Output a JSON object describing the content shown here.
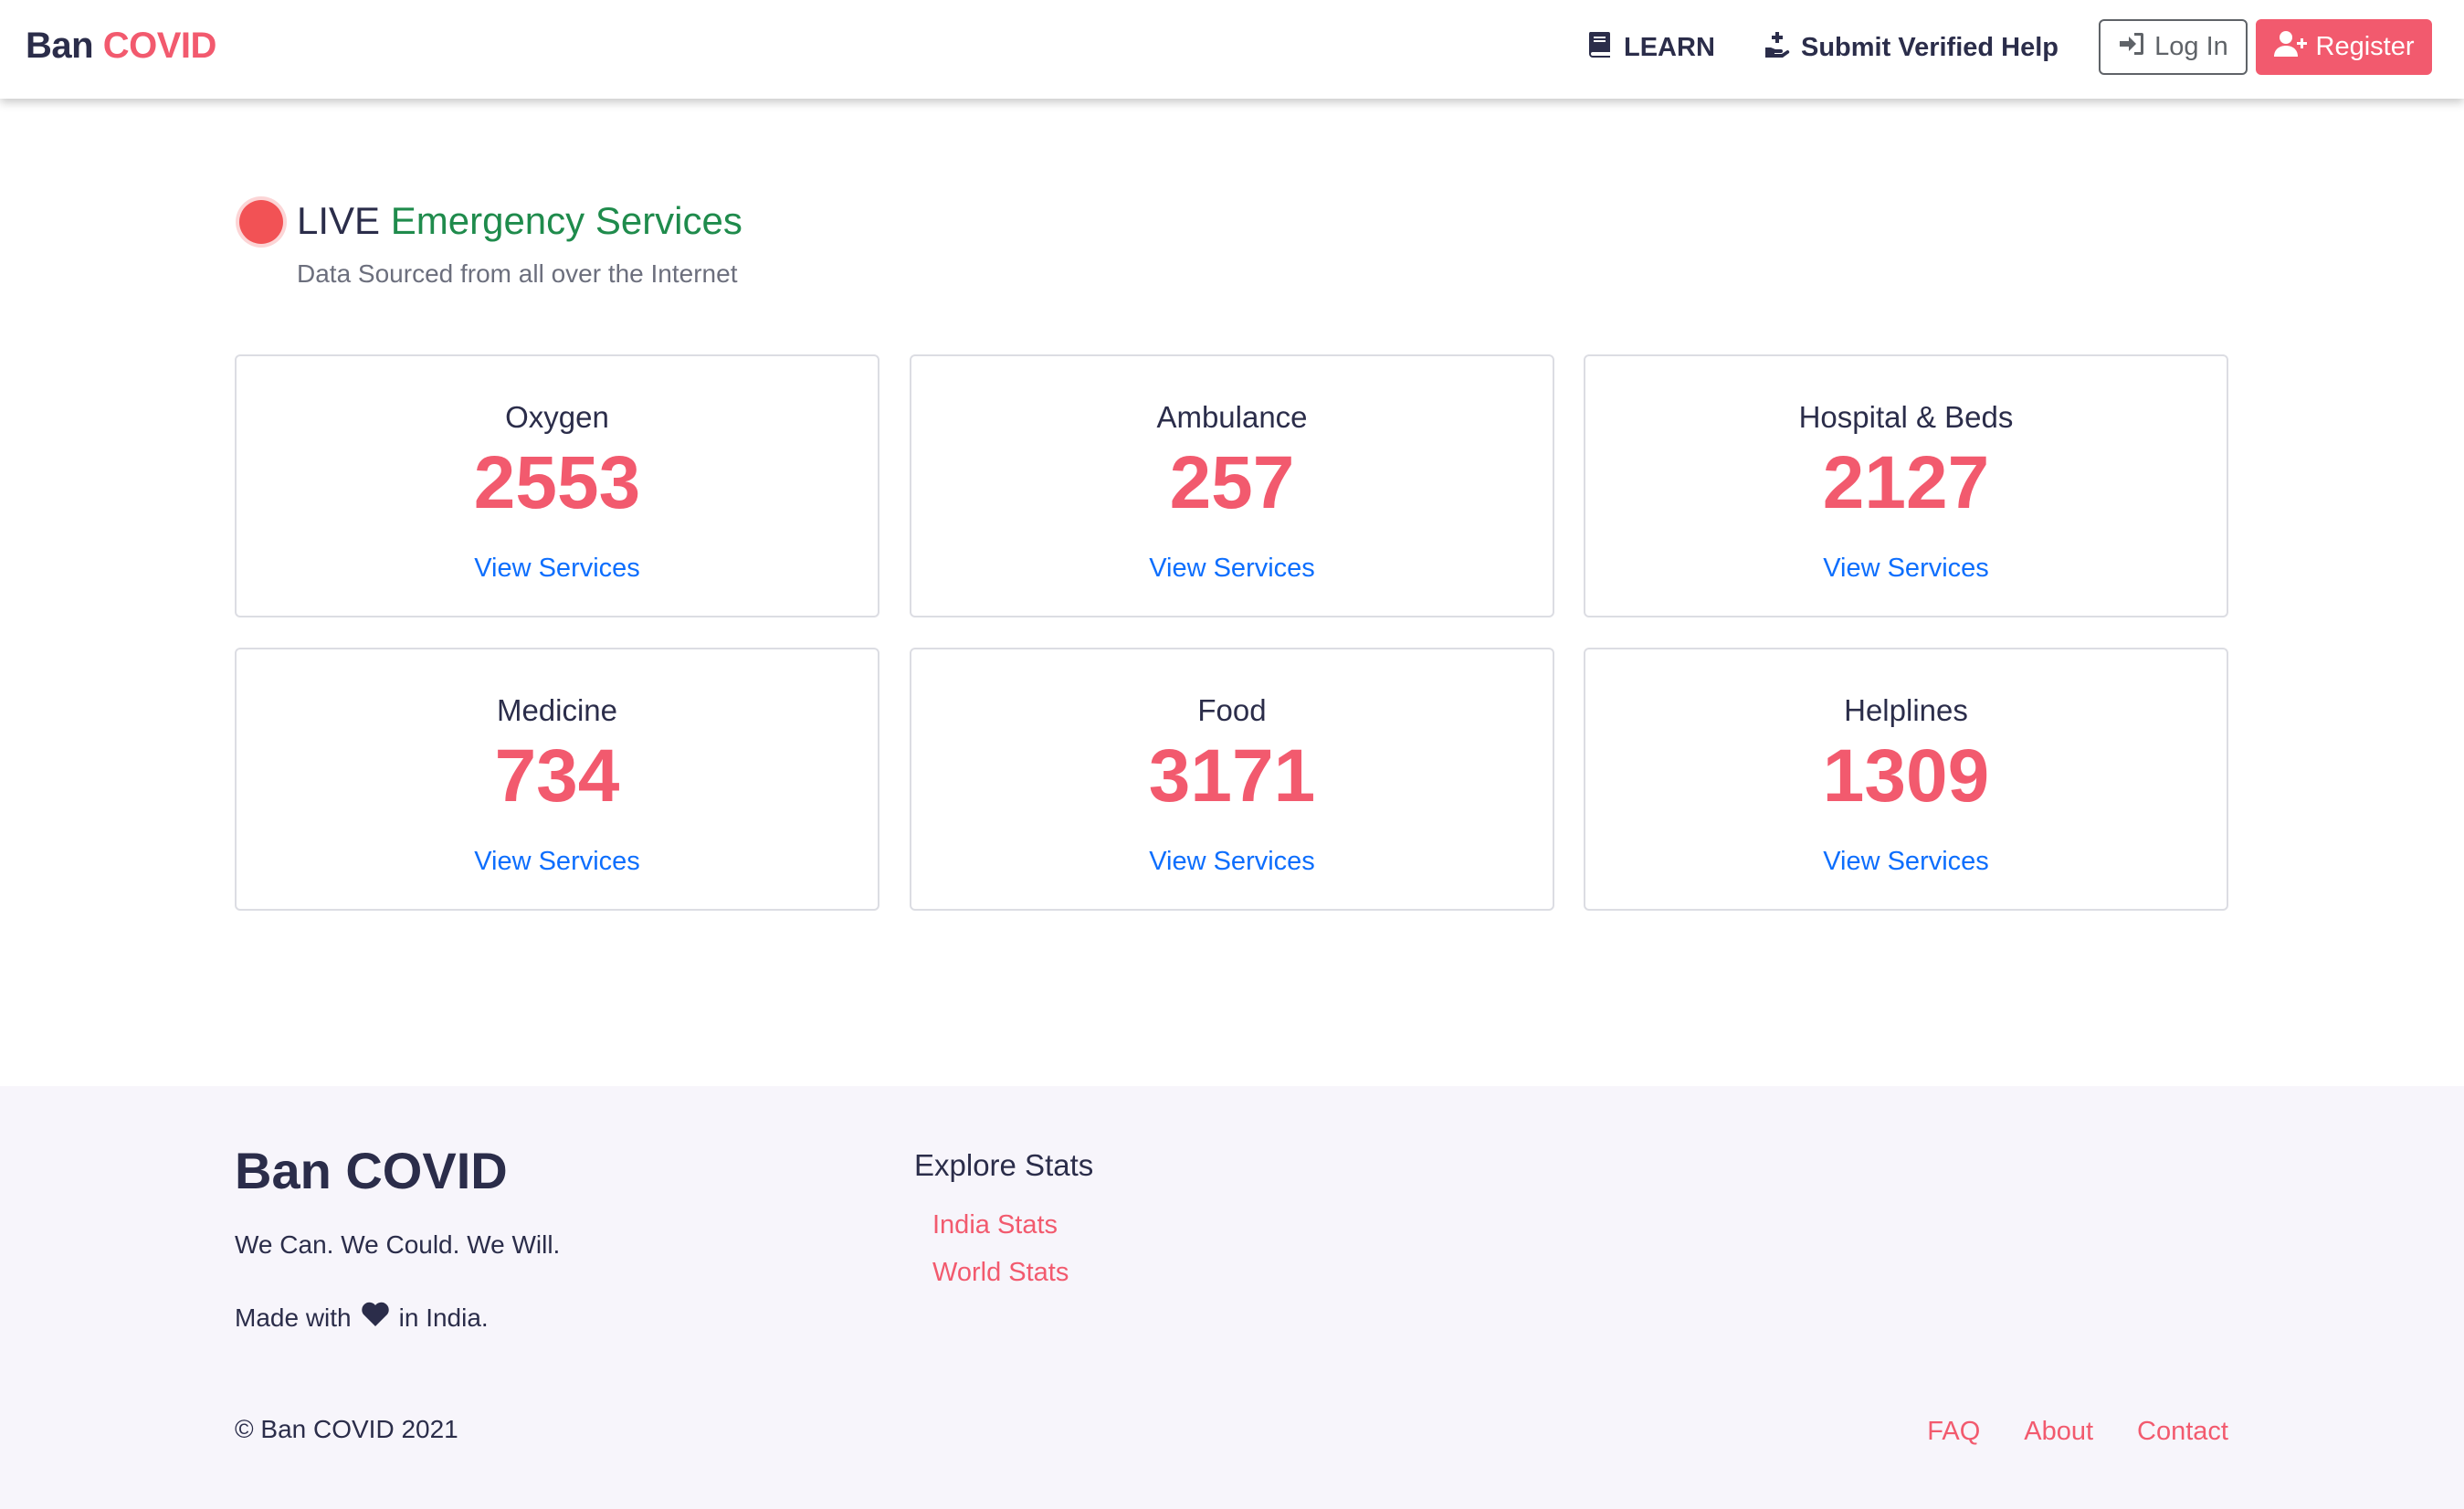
{
  "navbar": {
    "brand_part1": "Ban",
    "brand_part2": "COVID",
    "learn_label": "LEARN",
    "submit_label": "Submit Verified Help",
    "login_label": "Log In",
    "register_label": "Register"
  },
  "header": {
    "live_label": "LIVE",
    "title_label": "Emergency Services",
    "subtitle": "Data Sourced from all over the Internet"
  },
  "cards": [
    {
      "title": "Oxygen",
      "count": "2553",
      "link": "View Services"
    },
    {
      "title": "Ambulance",
      "count": "257",
      "link": "View Services"
    },
    {
      "title": "Hospital & Beds",
      "count": "2127",
      "link": "View Services"
    },
    {
      "title": "Medicine",
      "count": "734",
      "link": "View Services"
    },
    {
      "title": "Food",
      "count": "3171",
      "link": "View Services"
    },
    {
      "title": "Helplines",
      "count": "1309",
      "link": "View Services"
    }
  ],
  "footer": {
    "brand": "Ban COVID",
    "tagline": "We Can. We Could. We Will.",
    "made_prefix": "Made with",
    "made_suffix": "in India.",
    "explore_title": "Explore Stats",
    "stats_links": [
      "India Stats",
      "World Stats"
    ],
    "copyright": "© Ban COVID 2021",
    "links": [
      "FAQ",
      "About",
      "Contact"
    ]
  },
  "colors": {
    "accent": "#f25a6e",
    "green": "#1f8b4c",
    "link_blue": "#0d6efd",
    "dark": "#2b2d4a",
    "live_dot": "#f25255"
  },
  "icons": {
    "learn": "book-icon",
    "submit": "hand-holding-medical-icon",
    "login": "sign-in-icon",
    "register": "user-plus-icon",
    "heart": "heart-icon"
  }
}
